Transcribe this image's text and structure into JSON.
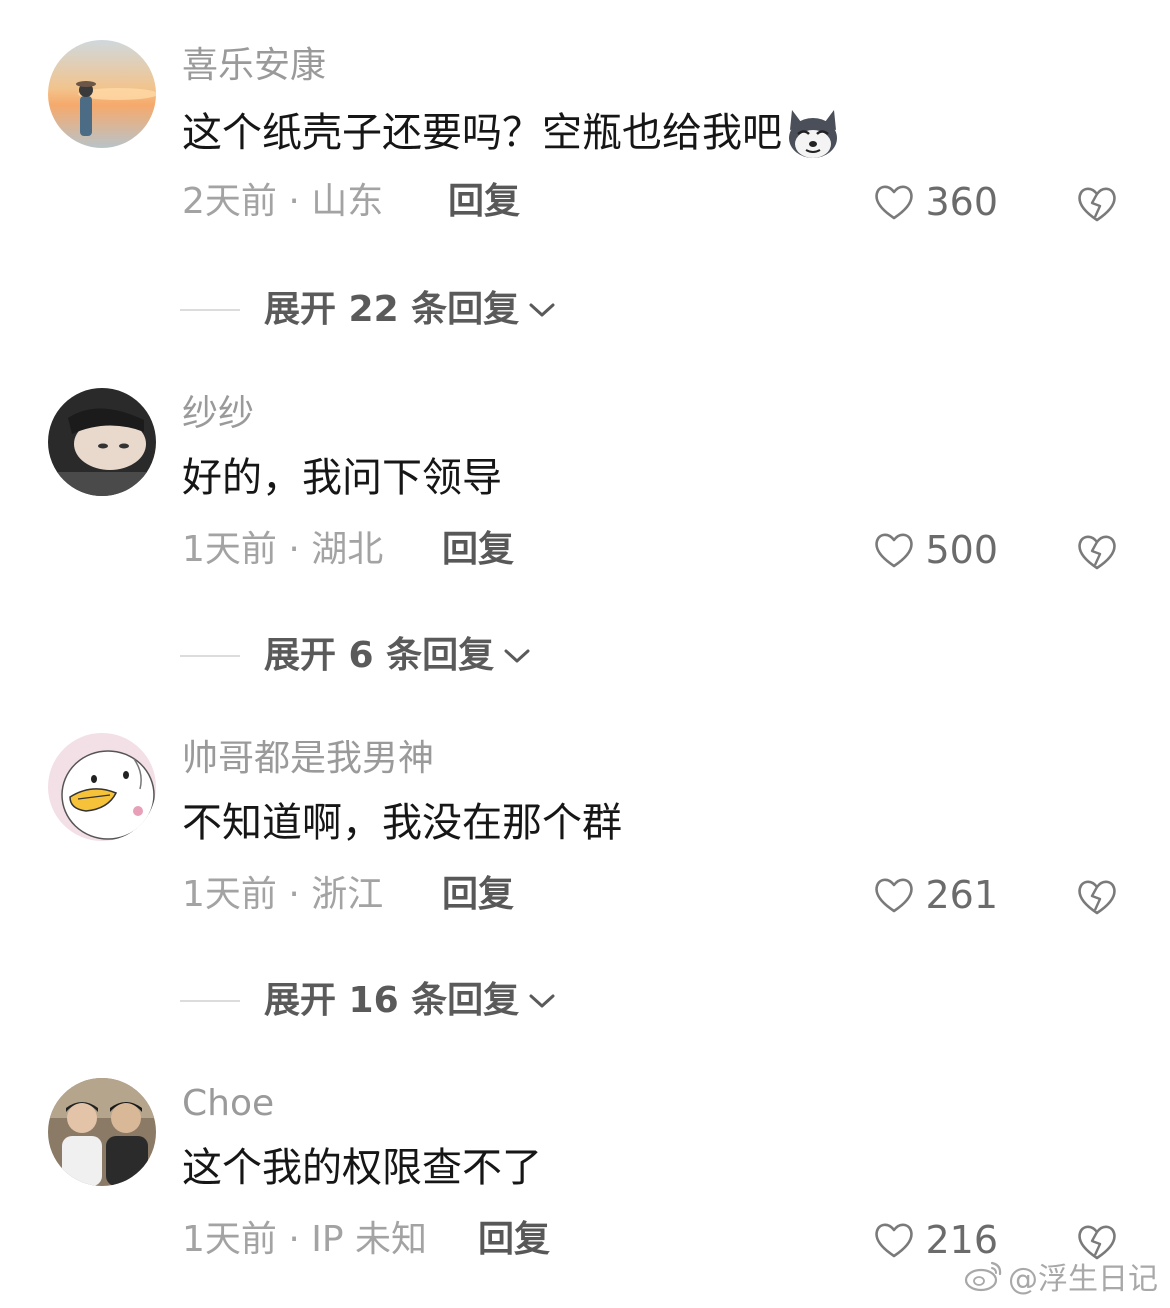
{
  "comments": [
    {
      "avatar": "avatar-sunset-girl",
      "username": "喜乐安康",
      "text": "这个纸壳子还要吗？空瓶也给我吧",
      "emoji": "husky-dog-emoji",
      "time_location": "2天前 · 山东",
      "reply_label": "回复",
      "likes": "360",
      "expand_label": "展开 22 条回复"
    },
    {
      "avatar": "avatar-lying-person",
      "username": "纱纱",
      "text": "好的，我问下领导",
      "time_location": "1天前 · 湖北",
      "reply_label": "回复",
      "likes": "500",
      "expand_label": "展开 6 条回复"
    },
    {
      "avatar": "avatar-cartoon-duck",
      "username": "帅哥都是我男神",
      "text": "不知道啊，我没在那个群",
      "time_location": "1天前 · 浙江",
      "reply_label": "回复",
      "likes": "261",
      "expand_label": "展开 16 条回复"
    },
    {
      "avatar": "avatar-two-men",
      "username": "Choe",
      "text": "这个我的权限查不了",
      "time_location": "1天前 · IP 未知",
      "reply_label": "回复",
      "likes": "216"
    }
  ],
  "watermark": {
    "icon": "weibo-icon",
    "text": "@浮生日记"
  },
  "colors": {
    "text_primary": "#161616",
    "text_secondary": "#9a9a9a",
    "reply": "#585858",
    "icon_gray": "#7a7a7a"
  }
}
